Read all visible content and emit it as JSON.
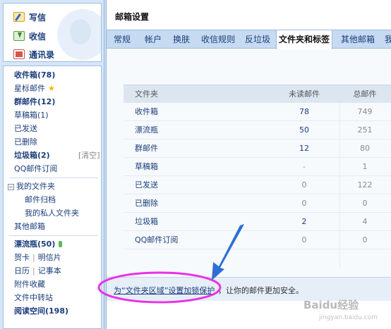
{
  "quick": {
    "compose": "写信",
    "inbox": "收信",
    "contacts": "通讯录"
  },
  "folders": {
    "inbox": "收件箱(78)",
    "starred": "星标邮件",
    "group": "群邮件(12)",
    "drafts": "草稿箱(1)",
    "sent": "已发送",
    "deleted": "已删除",
    "spam": "垃圾箱(2)",
    "spam_clear": "[清空]",
    "qq_subscribe": "QQ邮件订阅",
    "my_folders": "我的文件夹",
    "mail_archive": "邮件归档",
    "private_folder": "我的私人文件夹",
    "other_mailbox": "其他邮箱",
    "drift_bottle": "漂流瓶(50)",
    "card": "贺卡",
    "postcard": "明信片",
    "calendar": "日历",
    "notepad": "记事本",
    "attachments": "附件收藏",
    "file_transfer": "文件中转站",
    "reading_space": "阅读空间(198)"
  },
  "main": {
    "title": "邮箱设置",
    "tabs": [
      "常规",
      "帐户",
      "换肤",
      "收信规则",
      "反垃圾",
      "文件夹和标签",
      "其他邮箱",
      "我"
    ],
    "active_tab": "文件夹和标签",
    "table": {
      "headers": [
        "文件夹",
        "未读邮件",
        "总邮件"
      ],
      "rows": [
        [
          "收件箱",
          "78",
          "749"
        ],
        [
          "漂流瓶",
          "50",
          "251"
        ],
        [
          "群邮件",
          "12",
          "80"
        ],
        [
          "草稿箱",
          "-",
          "1"
        ],
        [
          "已发送",
          "0",
          "122"
        ],
        [
          "已删除",
          "0",
          "0"
        ],
        [
          "垃圾箱",
          "2",
          "4"
        ],
        [
          "QQ邮件订阅",
          "0",
          "0"
        ]
      ]
    },
    "protect_link": "为“文件夹区域”设置加锁保护",
    "protect_rest": "，让你的邮件更加安全。"
  },
  "watermark": {
    "brand": "Baidu经验",
    "url": "jingyan.baidu.com"
  },
  "colors": {
    "sidebar_bg": "#d6e6f7",
    "tab_bar": "#c6daf1",
    "link": "#1a3d7a",
    "annotation": "#e832e8"
  }
}
